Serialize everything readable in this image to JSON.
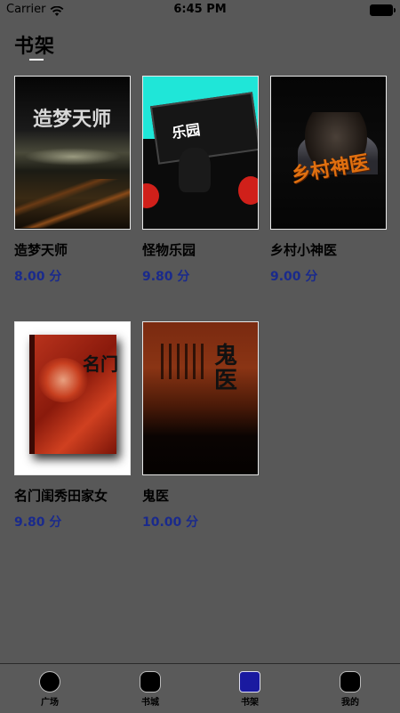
{
  "status_bar": {
    "carrier": "Carrier",
    "time": "6:45 PM"
  },
  "page": {
    "title": "书架"
  },
  "books": [
    {
      "title": "造梦天师",
      "score": "8.00 分",
      "cover_text": "造梦天师"
    },
    {
      "title": "怪物乐园",
      "score": "9.80 分",
      "cover_text": "乐园"
    },
    {
      "title": "乡村小神医",
      "score": "9.00 分",
      "cover_text": "乡村神医"
    },
    {
      "title": "名门闺秀田家女",
      "score": "9.80 分",
      "cover_text": "名门"
    },
    {
      "title": "鬼医",
      "score": "10.00 分",
      "cover_text": "鬼医"
    }
  ],
  "tab_bar": {
    "items": [
      {
        "label": "广场",
        "icon": "plaza-icon"
      },
      {
        "label": "书城",
        "icon": "bookstore-icon"
      },
      {
        "label": "书架",
        "icon": "bookshelf-icon",
        "active": true
      },
      {
        "label": "我的",
        "icon": "profile-icon"
      }
    ]
  },
  "colors": {
    "background": "#585858",
    "score": "#1a2a8c",
    "active_tab": "#1a1aa0"
  }
}
